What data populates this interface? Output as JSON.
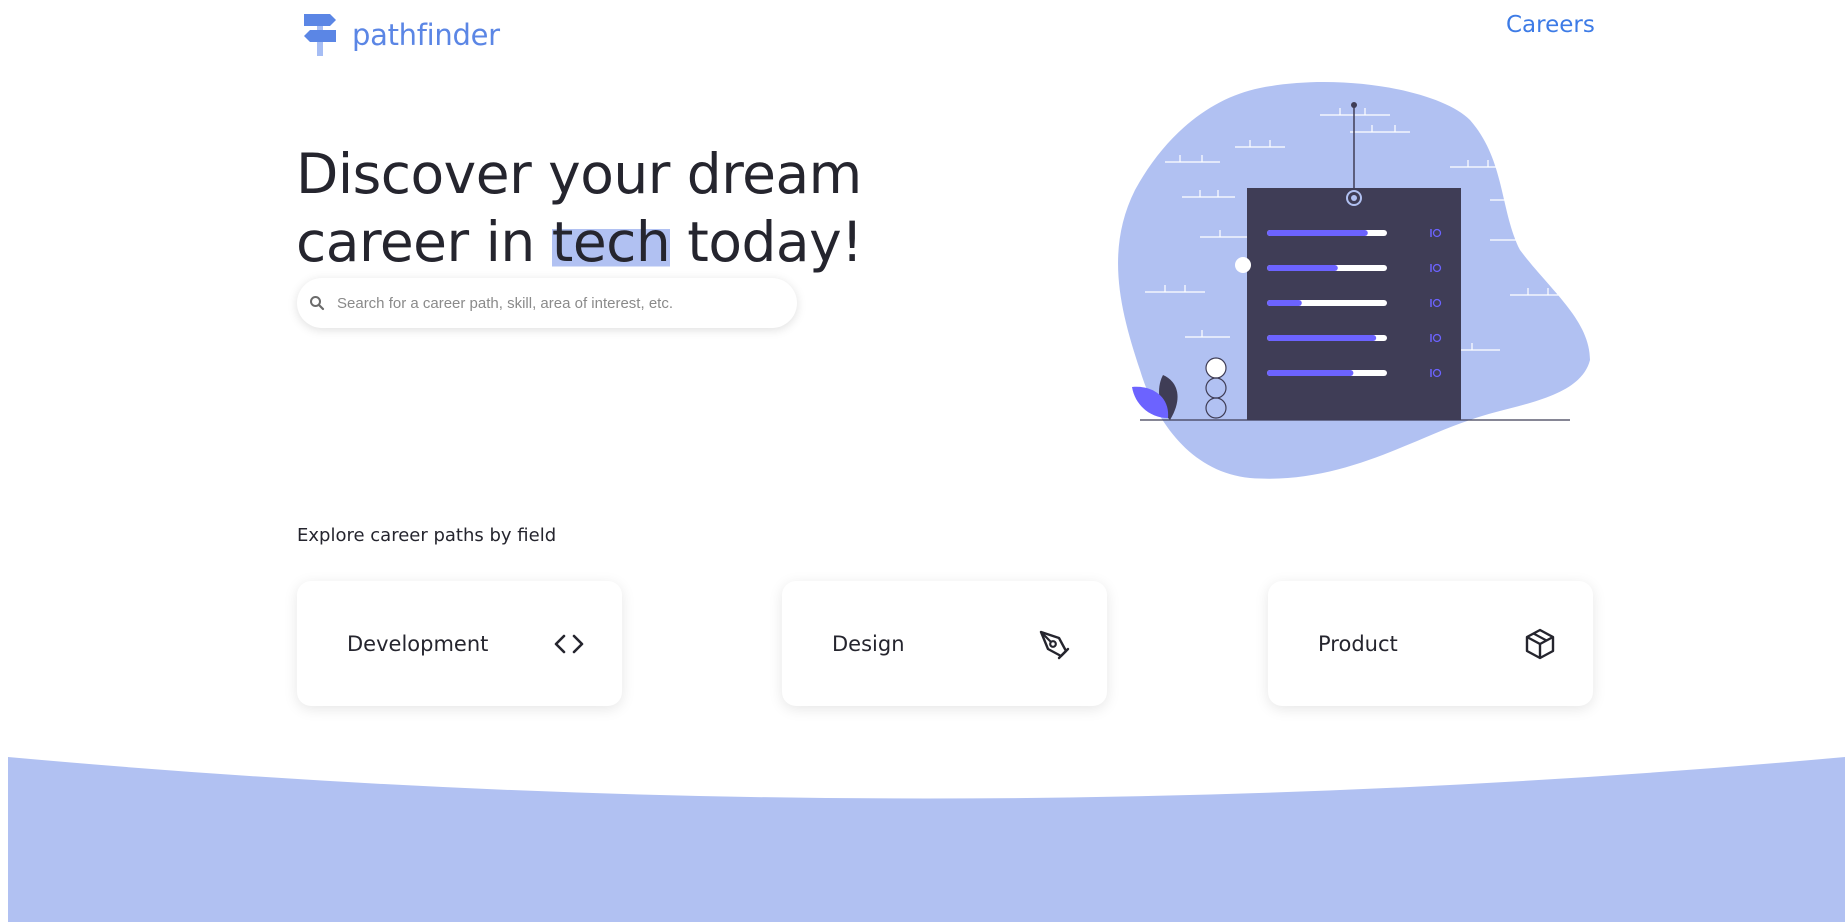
{
  "header": {
    "brand_name": "pathfinder",
    "nav_careers": "Careers"
  },
  "hero": {
    "title_part1": "Discover your dream",
    "title_part2": "career in ",
    "title_highlight": "tech",
    "title_part3": " today!"
  },
  "search": {
    "placeholder": "Search for a career path, skill, area of interest, etc.",
    "value": ""
  },
  "explore": {
    "heading": "Explore career paths by field",
    "cards": [
      {
        "label": "Development",
        "icon": "code-icon"
      },
      {
        "label": "Design",
        "icon": "pen-tool-icon"
      },
      {
        "label": "Product",
        "icon": "box-icon"
      }
    ]
  },
  "colors": {
    "brand": "#5b86e5",
    "accent_light": "#b1c1f2",
    "text_dark": "#25252e",
    "illustration_dark": "#3f3d56",
    "illustration_purple": "#6c63ff"
  },
  "illustration": {
    "progress_levels": [
      0.84,
      0.59,
      0.29,
      0.91,
      0.72
    ]
  }
}
